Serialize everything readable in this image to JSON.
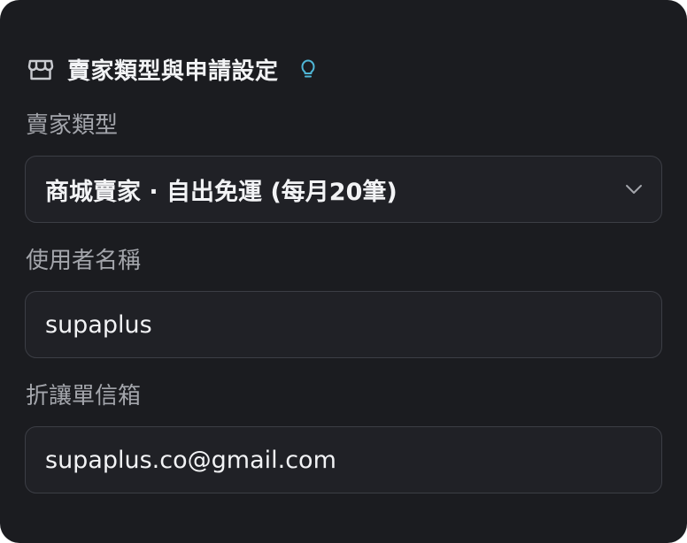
{
  "header": {
    "title": "賣家類型與申請設定",
    "icon": "store-icon",
    "hint_icon": "lightbulb-icon",
    "hint_color": "#4fb6d6"
  },
  "fields": {
    "seller_type": {
      "label": "賣家類型",
      "value": "商城賣家 · 自出免運 (每月20筆)",
      "icon": "chevron-down-icon"
    },
    "username": {
      "label": "使用者名稱",
      "value": "supaplus"
    },
    "discount_email": {
      "label": "折讓單信箱",
      "value": "supaplus.co@gmail.com"
    }
  },
  "colors": {
    "panel_bg": "#1b1c20",
    "field_bg": "#202126",
    "field_border": "#3c3e45",
    "text_primary": "#f2f3f5",
    "text_label": "#a3a5ab"
  }
}
